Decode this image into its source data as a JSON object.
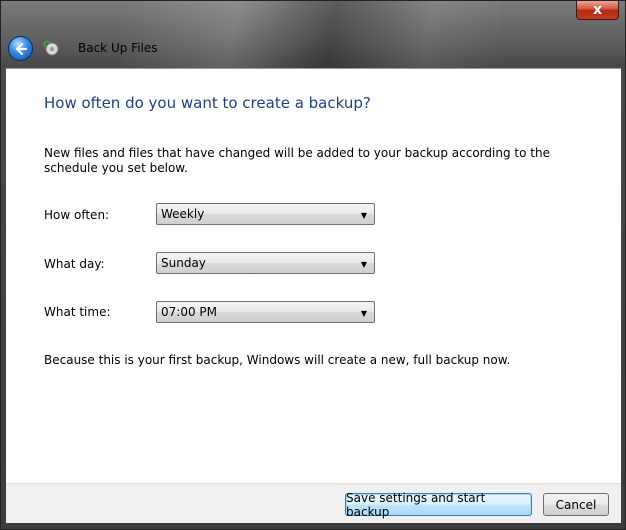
{
  "window": {
    "close_glyph": "x"
  },
  "nav": {
    "title": "Back Up Files"
  },
  "page": {
    "heading": "How often do you want to create a backup?",
    "description": "New files and files that have changed will be added to your backup according to the schedule you set below.",
    "note": "Because this is your first backup, Windows will create a new, full backup now."
  },
  "fields": {
    "how_often": {
      "label": "How often:",
      "value": "Weekly"
    },
    "what_day": {
      "label": "What day:",
      "value": "Sunday"
    },
    "what_time": {
      "label": "What time:",
      "value": "07:00 PM"
    }
  },
  "buttons": {
    "save": "Save settings and start backup",
    "cancel": "Cancel"
  },
  "colors": {
    "heading": "#1e3f8a",
    "primary_button_border": "#3c7fb1"
  }
}
